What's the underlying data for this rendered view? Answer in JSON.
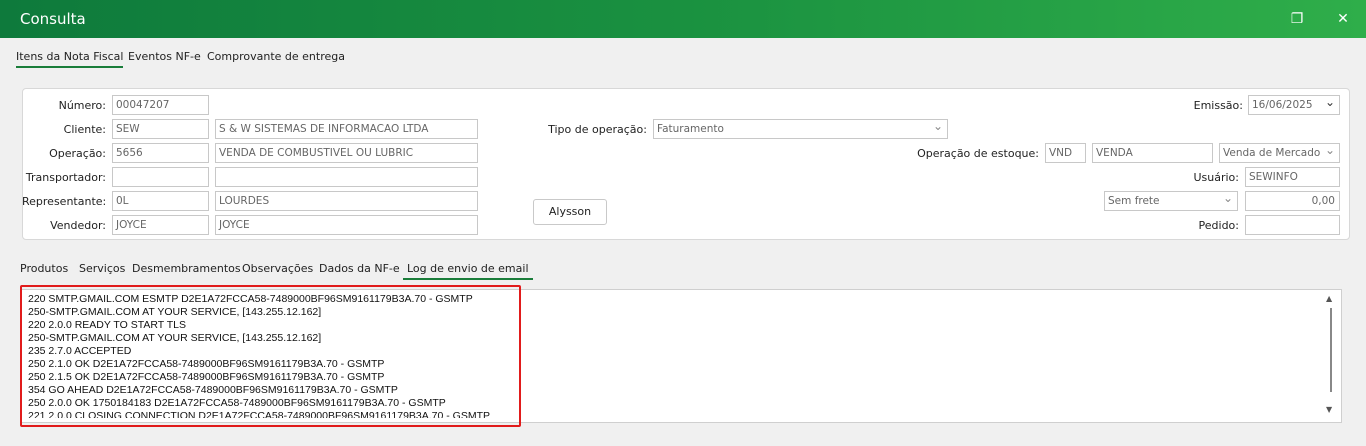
{
  "window": {
    "title": "Consulta",
    "restore_icon": "restore-icon",
    "close_icon": "close-icon"
  },
  "top_tabs": [
    "Itens da Nota Fiscal",
    "Eventos NF-e",
    "Comprovante de entrega"
  ],
  "form": {
    "numero_label": "Número:",
    "numero": "00047207",
    "cliente_label": "Cliente:",
    "cliente_code": "SEW",
    "cliente_name": "S & W SISTEMAS DE INFORMACAO LTDA",
    "operacao_label": "Operação:",
    "operacao_code": "5656",
    "operacao_name": "VENDA DE COMBUSTIVEL OU LUBRIC",
    "transportador_label": "Transportador:",
    "transportador_code": "",
    "transportador_name": "",
    "representante_label": "Representante:",
    "representante_code": "0L",
    "representante_name": "LOURDES",
    "vendedor_label": "Vendedor:",
    "vendedor_code": "JOYCE",
    "vendedor_name": "JOYCE",
    "tipo_operacao_label": "Tipo de operação:",
    "tipo_operacao": "Faturamento",
    "emissao_label": "Emissão:",
    "emissao": "16/06/2025",
    "operacao_estoque_label": "Operação de estoque:",
    "estoque_code": "VND",
    "estoque_name": "VENDA",
    "estoque_tipo": "Venda de Mercado",
    "usuario_label": "Usuário:",
    "usuario": "SEWINFO",
    "frete": "Sem frete",
    "frete_valor": "0,00",
    "pedido_label": "Pedido:",
    "pedido": "",
    "button_label": "Alysson"
  },
  "bottom_tabs": [
    "Produtos",
    "Serviços",
    "Desmembramentos",
    "Observações",
    "Dados da NF-e",
    "Log de envio de email"
  ],
  "log_lines": [
    "220 SMTP.GMAIL.COM ESMTP D2E1A72FCCA58-7489000BF96SM9161179B3A.70 - GSMTP",
    "250-SMTP.GMAIL.COM AT YOUR SERVICE, [143.255.12.162]",
    "220 2.0.0 READY TO START TLS",
    "250-SMTP.GMAIL.COM AT YOUR SERVICE, [143.255.12.162]",
    "235 2.7.0 ACCEPTED",
    "250 2.1.0 OK D2E1A72FCCA58-7489000BF96SM9161179B3A.70 - GSMTP",
    "250 2.1.5 OK D2E1A72FCCA58-7489000BF96SM9161179B3A.70 - GSMTP",
    "354 GO AHEAD D2E1A72FCCA58-7489000BF96SM9161179B3A.70 - GSMTP",
    "250 2.0.0 OK  1750184183 D2E1A72FCCA58-7489000BF96SM9161179B3A.70 - GSMTP",
    "221 2.0.0 CLOSING CONNECTION D2E1A72FCCA58-7489000BF96SM9161179B3A.70 - GSMTP"
  ],
  "colors": {
    "title_bar_start": "#0e7a3c",
    "title_bar_end": "#2fae4a",
    "tab_underline": "#1a7d3a",
    "highlight": "#e11b1b"
  }
}
